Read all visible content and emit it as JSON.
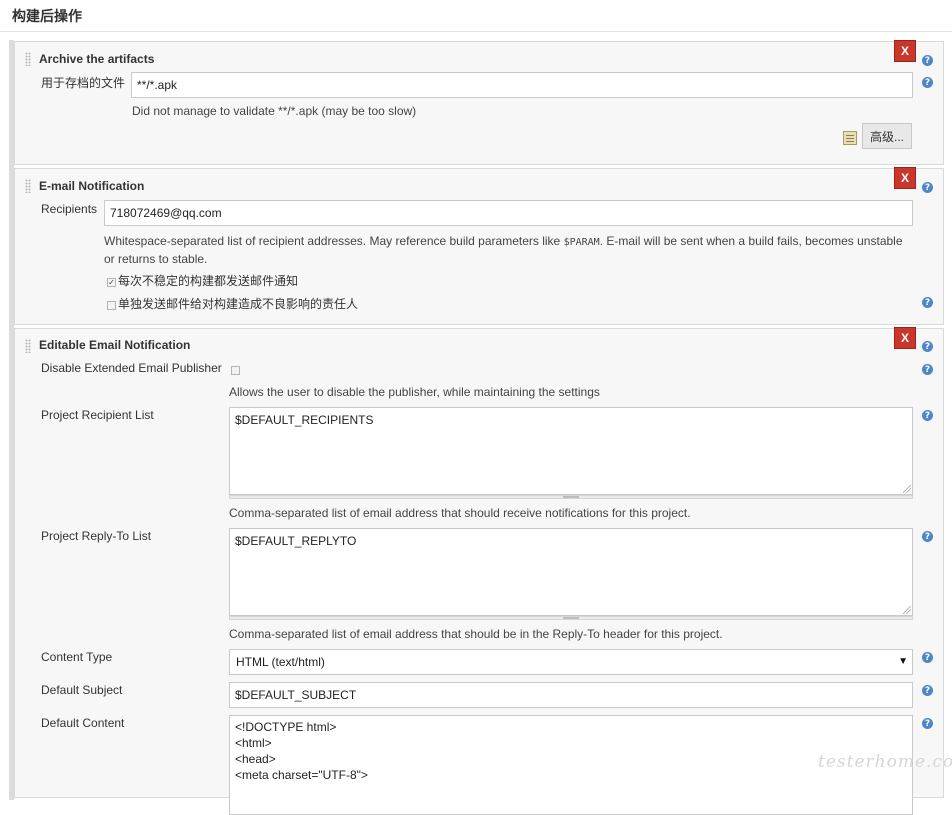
{
  "page": {
    "section_title": "构建后操作"
  },
  "archive": {
    "title": "Archive the artifacts",
    "delete_label": "X",
    "files_label": "用于存档的文件",
    "files_value": "**/*.apk",
    "validation_msg": "Did not manage to validate **/*.apk (may be too slow)",
    "advanced_label": "高级..."
  },
  "email": {
    "title": "E-mail Notification",
    "delete_label": "X",
    "recipients_label": "Recipients",
    "recipients_value": "718072469@qq.com",
    "desc_pre": "Whitespace-separated list of recipient addresses. May reference build parameters like ",
    "desc_param": "$PARAM",
    "desc_post": ". E-mail will be sent when a build fails, becomes unstable or returns to stable.",
    "opt_unstable_label": "每次不稳定的构建都发送邮件通知",
    "opt_unstable_checked": true,
    "opt_individual_label": "单独发送邮件给对构建造成不良影响的责任人",
    "opt_individual_checked": false
  },
  "ext_email": {
    "title": "Editable Email Notification",
    "delete_label": "X",
    "disable_label": "Disable Extended Email Publisher",
    "disable_checked": false,
    "disable_desc": "Allows the user to disable the publisher, while maintaining the settings",
    "recipient_list_label": "Project Recipient List",
    "recipient_list_value": "$DEFAULT_RECIPIENTS",
    "recipient_list_desc": "Comma-separated list of email address that should receive notifications for this project.",
    "replyto_label": "Project Reply-To List",
    "replyto_value": "$DEFAULT_REPLYTO",
    "replyto_desc": "Comma-separated list of email address that should be in the Reply-To header for this project.",
    "content_type_label": "Content Type",
    "content_type_value": "HTML (text/html)",
    "subject_label": "Default Subject",
    "subject_value": "$DEFAULT_SUBJECT",
    "content_label": "Default Content",
    "content_lines": [
      "<!DOCTYPE html>",
      "<html>",
      "<head>",
      "<meta charset=\"UTF-8\">"
    ]
  },
  "watermark": "testerhome.com",
  "help_icon_glyph": "?",
  "icons": {
    "delete": "close-x-icon",
    "help": "help-question-icon",
    "notepad": "notepad-icon",
    "drag": "drag-handle-icon",
    "select_arrow": "dropdown-arrow-icon"
  },
  "colors": {
    "delete_button": "#c9362a",
    "help_icon": "#4d87c7",
    "block_background": "#f7f7f7"
  }
}
